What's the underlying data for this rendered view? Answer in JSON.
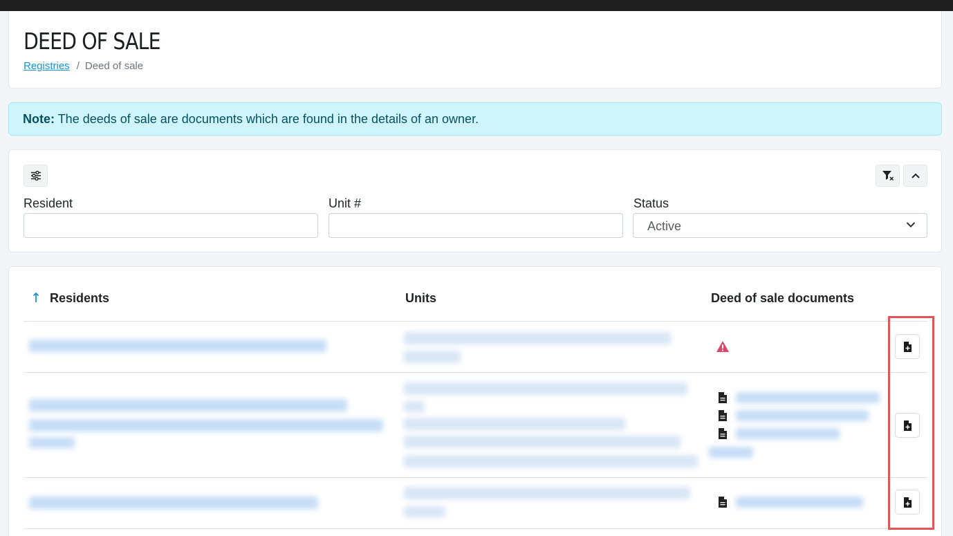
{
  "header": {
    "title": "DEED OF SALE",
    "breadcrumb": {
      "link": "Registries",
      "separator": "/",
      "current": "Deed of sale"
    }
  },
  "note": {
    "label": "Note:",
    "text": "The deeds of sale are documents which are found in the details of an owner."
  },
  "filters": {
    "resident_label": "Resident",
    "resident_value": "",
    "unit_label": "Unit #",
    "unit_value": "",
    "status_label": "Status",
    "status_value": "Active"
  },
  "table": {
    "columns": [
      "Residents",
      "Units",
      "Deed of sale documents"
    ],
    "sort_column": "Residents",
    "sort_direction": "ascending",
    "rows": [
      {
        "documents_state": "warning",
        "document_count": 0
      },
      {
        "documents_state": "documents",
        "document_count": 3
      },
      {
        "documents_state": "documents",
        "document_count": 1
      }
    ]
  },
  "colors": {
    "accent": "#1596d6",
    "note_bg": "#cff4fc",
    "warning": "#dc3545",
    "highlight": "#e05555"
  },
  "icons": [
    "sliders-icon",
    "filter-clear-icon",
    "chevron-up-icon",
    "chevron-down-icon",
    "sort-up-arrow-icon",
    "warning-triangle-icon",
    "document-icon",
    "add-document-icon"
  ]
}
